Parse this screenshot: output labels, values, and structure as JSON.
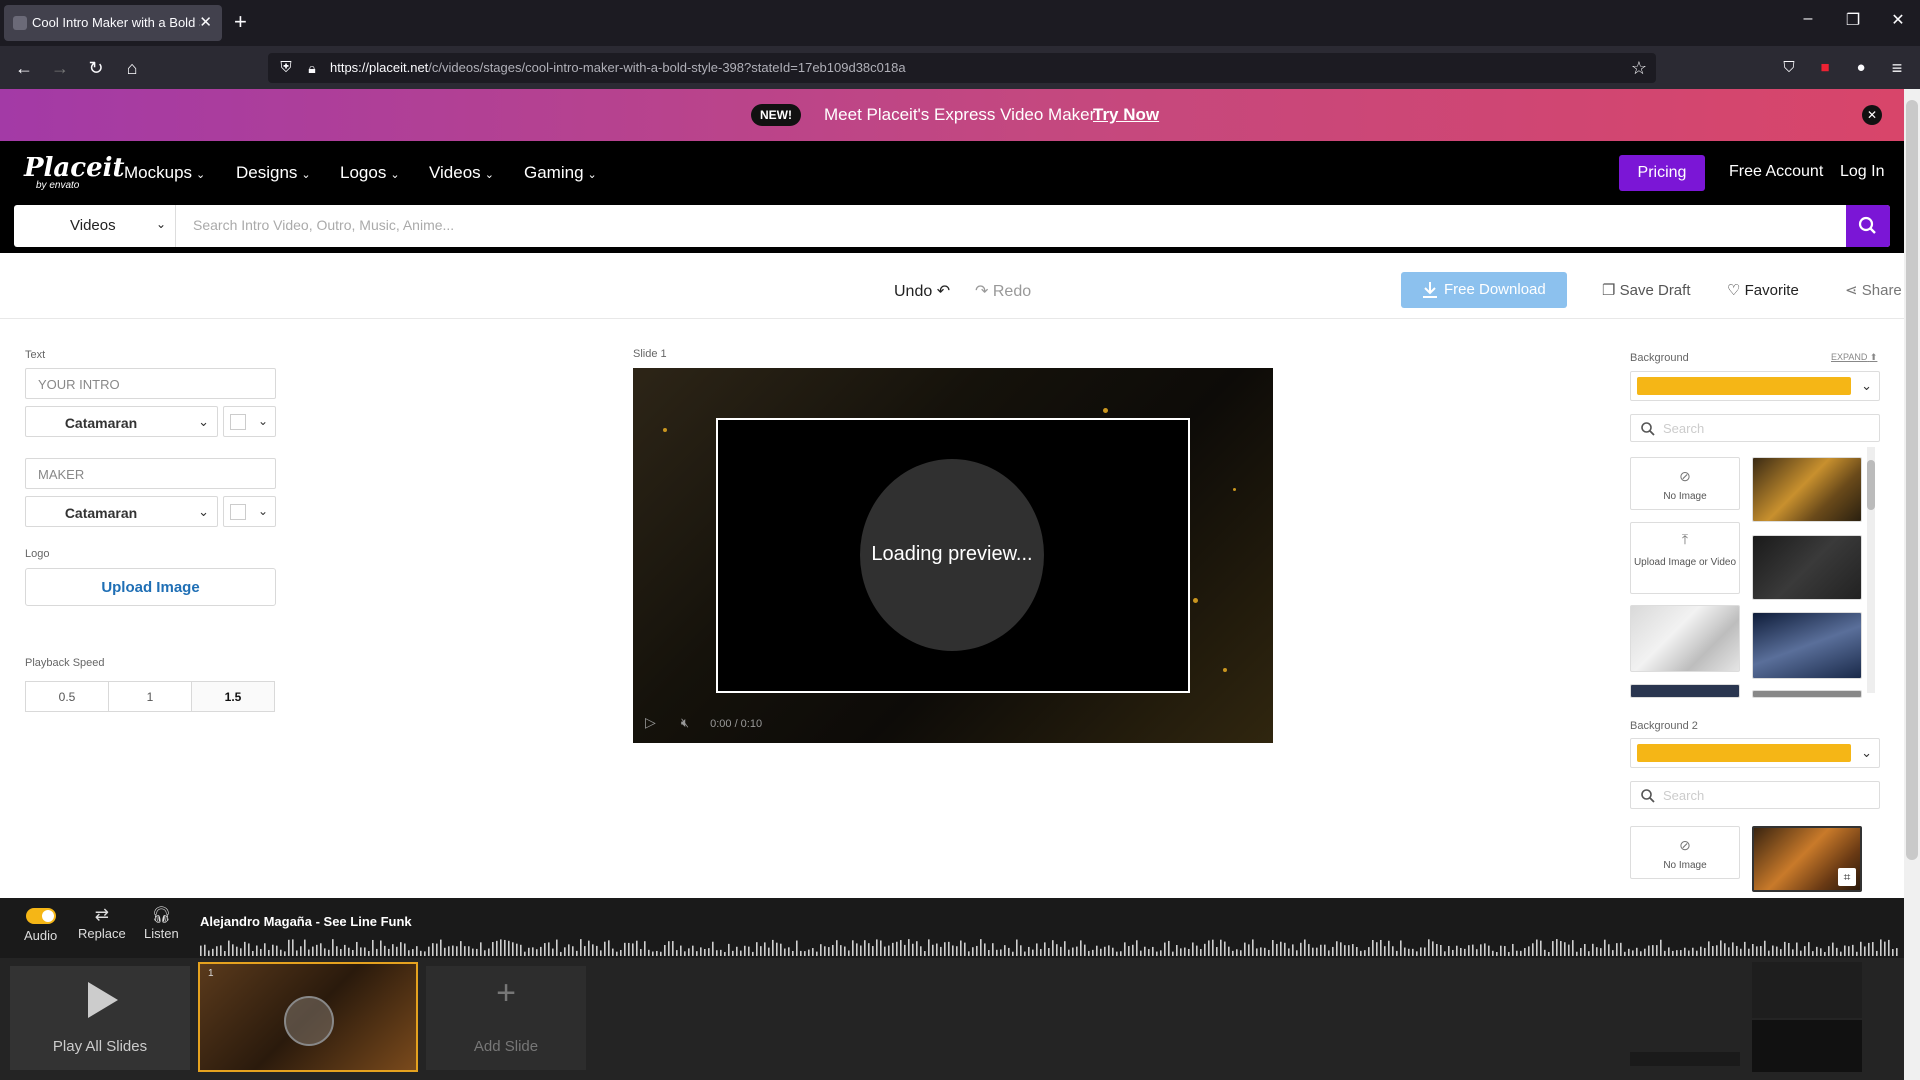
{
  "browser": {
    "tab_title": "Cool Intro Maker with a Bold St",
    "url_host": "https://placeit.net",
    "url_path": "/c/videos/stages/cool-intro-maker-with-a-bold-style-398?stateId=17eb109d38c018a"
  },
  "banner": {
    "badge": "NEW!",
    "text": "Meet Placeit's Express Video Maker!",
    "link": "Try Now"
  },
  "site": {
    "logo": "Placeit",
    "logo_sub": "by envato",
    "nav": [
      "Mockups",
      "Designs",
      "Logos",
      "Videos",
      "Gaming"
    ],
    "pricing": "Pricing",
    "free_account": "Free Account",
    "login": "Log In"
  },
  "search": {
    "category": "Videos",
    "placeholder": "Search Intro Video, Outro, Music, Anime..."
  },
  "toolbar": {
    "undo": "Undo",
    "redo": "Redo",
    "free_download": "Free Download",
    "save_draft": "Save Draft",
    "favorite": "Favorite",
    "share": "Share"
  },
  "left": {
    "text_label": "Text",
    "field1_placeholder": "YOUR INTRO",
    "font1": "Catamaran",
    "field2_placeholder": "MAKER",
    "font2": "Catamaran",
    "logo_label": "Logo",
    "upload": "Upload Image",
    "speed_label": "Playback Speed",
    "speeds": [
      "0.5",
      "1",
      "1.5"
    ],
    "active_speed": "1.5"
  },
  "preview": {
    "slide_label": "Slide 1",
    "loading": "Loading preview...",
    "time": "0:00 / 0:10"
  },
  "right": {
    "bg1_label": "Background",
    "expand": "EXPAND",
    "bg1_color": "#f5b616",
    "search_placeholder": "Search",
    "no_image": "No Image",
    "upload_media": "Upload Image or Video",
    "bg2_label": "Background 2",
    "bg2_color": "#f5b616"
  },
  "audio": {
    "audio_label": "Audio",
    "replace_label": "Replace",
    "listen_label": "Listen",
    "track": "Alejandro Magaña - See Line Funk"
  },
  "slides": {
    "play_all": "Play All Slides",
    "slide_number": "1",
    "add_slide": "Add Slide"
  }
}
